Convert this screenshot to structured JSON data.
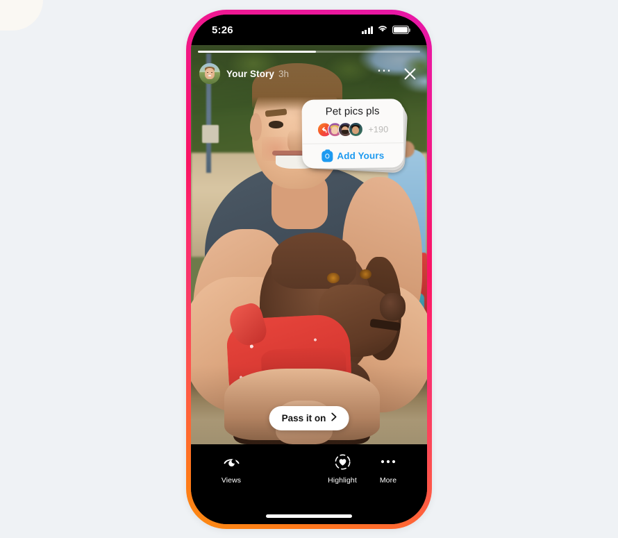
{
  "app": {
    "name": "Instagram Stories",
    "accent_pink": "#e617a8",
    "accent_orange": "#fb8c13",
    "link_blue": "#1e9af0"
  },
  "status_bar": {
    "time": "5:26",
    "signal_icon": "cellular-bars-icon",
    "wifi_icon": "wifi-icon",
    "battery_icon": "battery-full-icon",
    "battery_level": 100
  },
  "story": {
    "progress_percent": 53,
    "segments": 1,
    "header": {
      "avatar_name": "avatar",
      "username": "Your Story",
      "timestamp": "3h",
      "more_icon": "ellipsis-icon",
      "close_icon": "close-icon"
    },
    "media": {
      "description": "Young man on a beach hugging a brown pointer dog wearing a red bandana"
    }
  },
  "sticker": {
    "type": "add-yours-sticker",
    "prompt": "Pet pics pls",
    "participant_overflow": "+190",
    "participants": [
      {
        "name": "reply-arrow-avatar",
        "kind": "reply"
      },
      {
        "name": "participant-avatar-1",
        "kind": "face"
      },
      {
        "name": "participant-avatar-2",
        "kind": "face"
      },
      {
        "name": "participant-avatar-3",
        "kind": "face"
      }
    ],
    "cta_label": "Add Yours",
    "cta_icon": "camera-icon"
  },
  "pass_it_on": {
    "label": "Pass it on",
    "chevron_icon": "chevron-right-icon"
  },
  "bottom_bar": {
    "actions": [
      {
        "label": "Views",
        "icon": "eye-icon"
      },
      {
        "label": "Highlight",
        "icon": "heart-in-dashed-circle-icon"
      },
      {
        "label": "More",
        "icon": "ellipsis-icon"
      }
    ],
    "home_indicator": "home-indicator"
  }
}
